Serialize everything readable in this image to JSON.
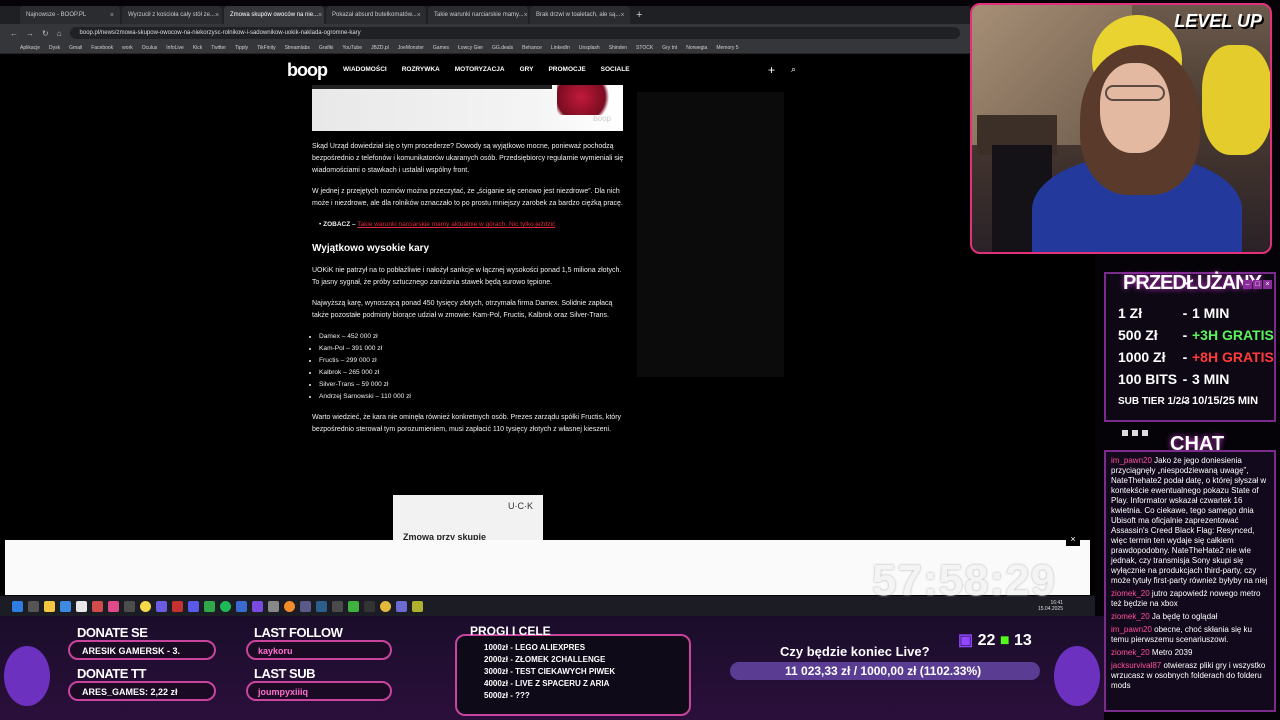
{
  "browser": {
    "tabs": [
      {
        "label": "Najnowsze - BOOP.PL"
      },
      {
        "label": "Wyrzucił z kościoła cały stół ze..."
      },
      {
        "label": "Zmowa skupów owoców na nie..."
      },
      {
        "label": "Pokazał absurd butelkomatów..."
      },
      {
        "label": "Takie warunki narciarskie mamy..."
      },
      {
        "label": "Brak drzwi w toaletach, ale są..."
      }
    ],
    "new_tab": "+",
    "url": "boop.pl/news/zmowa-skupow-owocow-na-niekorzysc-rolnikow-i-sadownikow-uokik-naklada-ogromne-kary",
    "bookmarks": [
      "Aplikacje",
      "Dysk",
      "Gmail",
      "Facebook",
      "work",
      "Oculus",
      "InfoLive",
      "Kick",
      "Twitter",
      "Tipply",
      "TikFinity",
      "Streamlabs",
      "Grafiki",
      "YouTube",
      "JBZD.pl",
      "JoeMonster",
      "Games",
      "Łowcy Gier",
      "GG.deals",
      "Behance",
      "LinkedIn",
      "Unsplash",
      "Shinden",
      "STOCK",
      "Gry tnt",
      "Norwegia",
      "Memory 5"
    ]
  },
  "site": {
    "logo": "boop",
    "nav": [
      "WIADOMOŚCI",
      "ROZRYWKA",
      "MOTORYZACJA",
      "GRY",
      "PROMOCJE",
      "SOCIALE"
    ],
    "plus": "+",
    "hero_watermark": "boop"
  },
  "article": {
    "p1": "Skąd Urząd dowiedział się o tym procederze? Dowody są wyjątkowo mocne, ponieważ pochodzą bezpośrednio z telefonów i komunikatorów ukaranych osób. Przedsiębiorcy regularnie wymieniali się wiadomościami o stawkach i ustalali wspólny front.",
    "p2": "W jednej z przejętych rozmów można przeczytać, że „ściganie się cenowo jest niezdrowe”. Dla nich może i niezdrowe, ale dla rolników oznaczało to po prostu mniejszy zarobek za bardzo ciężką pracę.",
    "zobacz_label": "ZOBACZ –",
    "zobacz_link": "Takie warunki narciarskie mamy aktualnie w górach. Nic tylko jeździć",
    "heading": "Wyjątkowo wysokie kary",
    "p3": "UOKiK nie patrzył na to pobłażliwie i nałożył sankcje w łącznej wysokości ponad 1,5 miliona złotych. To jasny sygnał, że próby sztucznego zaniżania stawek będą surowo tępione.",
    "p4": "Najwyższą karę, wynoszącą ponad 450 tysięcy złotych, otrzymała firma Damex. Solidnie zapłacą także pozostałe podmioty biorące udział w zmowie: Kam-Pol, Fructis, Kalbrok oraz Silver-Trans.",
    "fines": [
      "Damex – 452 000 zł",
      "Kam-Pol – 391 000 zł",
      "Fructis – 299 000 zł",
      "Kalbrok – 265 000 zł",
      "Silver-Trans – 59 000 zł",
      "Andrzej Sarnowski – 110 000 zł"
    ],
    "p5": "Warto wiedzieć, że kara nie ominęła również konkretnych osób. Prezes zarządu spółki Fructis, który bezpośrednio sterował tym porozumieniem, musi zapłacić 110 tysięcy złotych z własnej kieszeni.",
    "card_logo": "U·C·K",
    "card_title": "Zmowa przy skupie",
    "banner_close": "×"
  },
  "taskbar": {
    "time": "16:41",
    "date": "15.04.2025"
  },
  "stream": {
    "webcam_overlay": "LEVEL UP",
    "panel_title": "PRZEDŁUŻANY",
    "rates": [
      {
        "amount": "1 Zł",
        "value": "1 MIN"
      },
      {
        "amount": "500 Zł",
        "value": "+3H GRATIS"
      },
      {
        "amount": "1000 Zł",
        "value": "+8H GRATIS"
      },
      {
        "amount": "100 BITS",
        "value": "3 MIN"
      },
      {
        "amount": "SUB TIER 1/2/3",
        "value": "10/15/25 MIN"
      }
    ],
    "chat_title": "CHAT",
    "chat": [
      {
        "user": "im_pawn20",
        "text": "Jako że jego doniesienia przyciągnęły „niespodziewaną uwagę”, NateThehate2 podał datę, o której słyszał w kontekście ewentualnego pokazu State of Play. Informator wskazał czwartek 16 kwietnia. Co ciekawe, tego samego dnia Ubisoft ma oficjalnie zaprezentować Assassin's Creed Black Flag: Resynced, więc termin ten wydaje się całkiem prawdopodobny. NateTheHate2 nie wie jednak, czy transmisja Sony skupi się wyłącznie na produkcjach third-party, czy może tytuły first-party również byłyby na niej"
      },
      {
        "user": "ziomek_20",
        "text": "jutro zapowiedź nowego metro też będzie na xbox"
      },
      {
        "user": "ziomek_20",
        "text": "Ja będę to oglądał"
      },
      {
        "user": "im_pawn20",
        "text": "obecne, choć skłania się ku temu pierwszemu scenariuszowi."
      },
      {
        "user": "ziomek_20",
        "text": "Metro 2039"
      },
      {
        "user": "jacksurvival87",
        "text": "otwierasz pliki gry i wszystko wrzucasz w osobnych folderach do folderu mods"
      }
    ],
    "donate_label": "DONATE SE",
    "donate_value": "ARESIK GAMERSK - 3.",
    "donate2_label": "DONATE TT",
    "donate2_value": "ARES_GAMES: 2,22 zł",
    "last_follow_label": "LAST FOLLOW",
    "last_follow_value": "kaykoru",
    "last_sub_label": "LAST SUB",
    "last_sub_value": "joumpyxiiiq",
    "goals_title": "PROGI I CELE",
    "goals": [
      "1000zł - LEGO ALIEXPRES",
      "2000zł - ZŁOMEK 2CHALLENGE",
      "3000zł - TEST CIEKAWYCH PIWEK",
      "4000zł - LIVE Z SPACERU Z ARIA",
      "5000zł - ???"
    ],
    "live_question": "Czy będzie koniec Live?",
    "live_progress": "11 023,33 zł / 1000,00 zł (1102.33%)",
    "viewers_count": "22",
    "kick_count": "13",
    "timer": "57:58:29"
  }
}
